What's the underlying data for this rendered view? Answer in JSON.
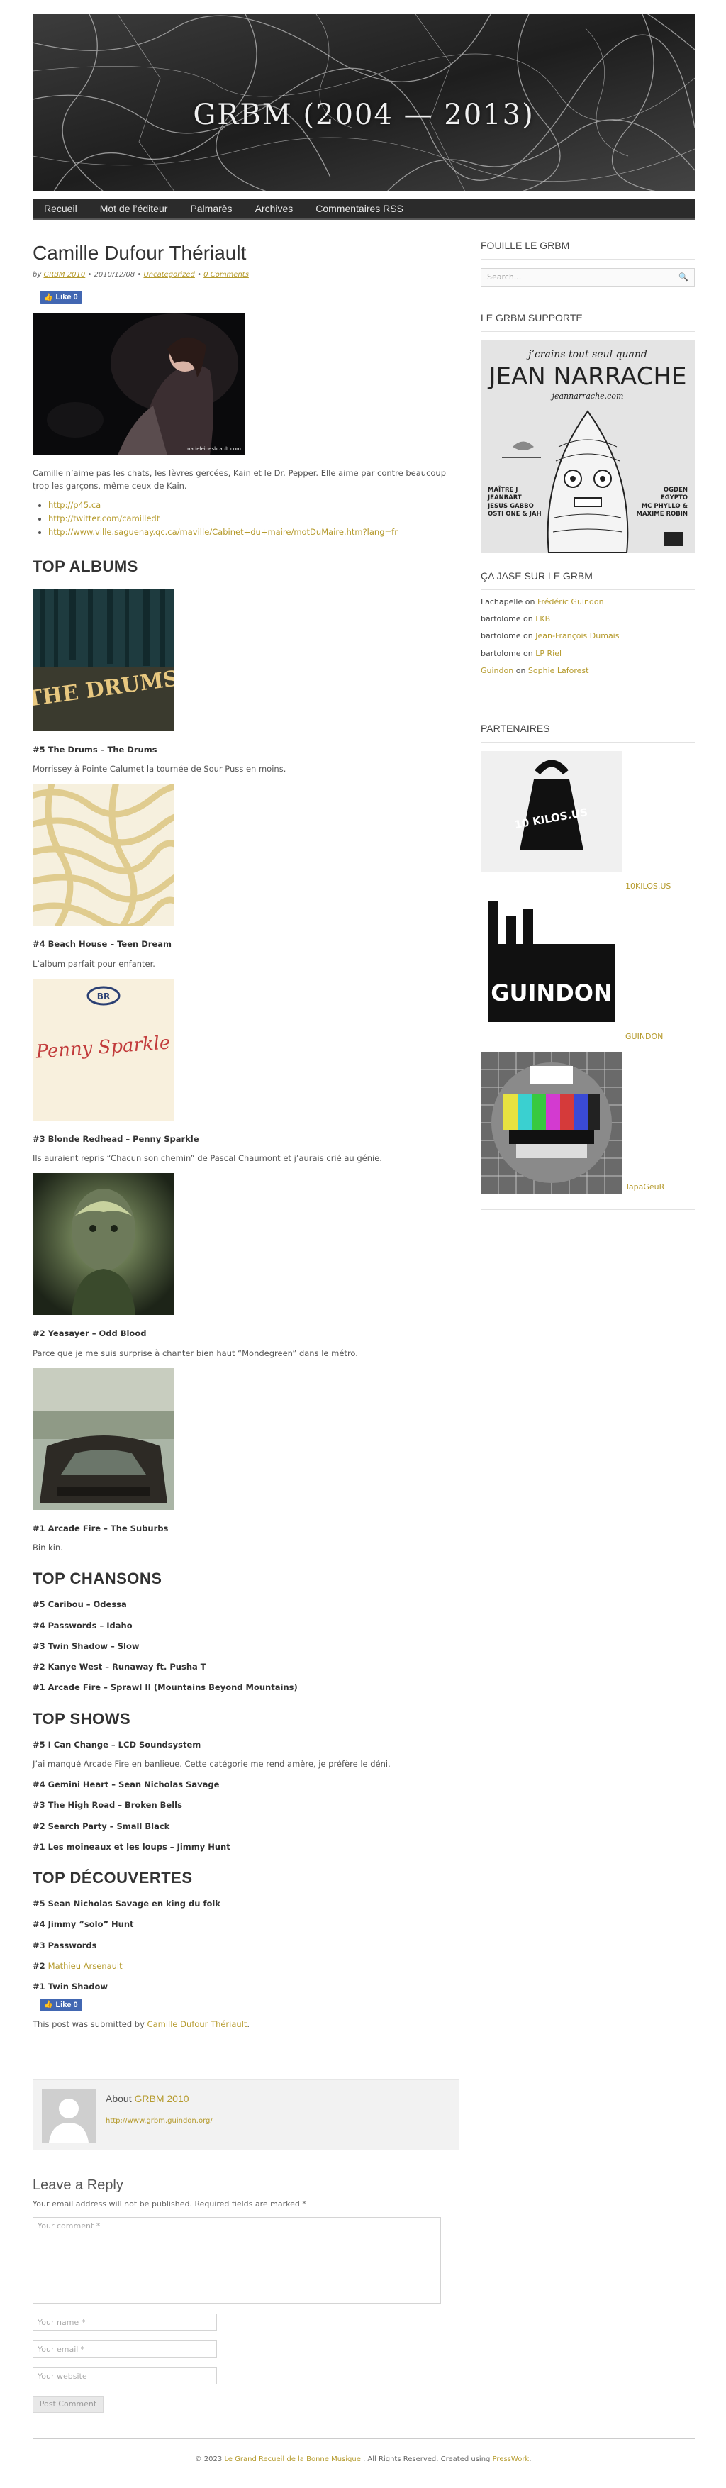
{
  "site": {
    "banner_title": "GRBM (2004 — 2013)",
    "nav": [
      "Recueil",
      "Mot de l’éditeur",
      "Palmarès",
      "Archives",
      "Commentaires RSS"
    ]
  },
  "post": {
    "title": "Camille Dufour Thériault",
    "meta_by": "by",
    "meta_author": "GRBM 2010",
    "meta_date": " • 2010/12/08 • ",
    "meta_category": "Uncategorized",
    "meta_sep": " • ",
    "meta_comments": "0 Comments",
    "like_label": "Like 0",
    "image_watermark": "madeleinesbrault.com",
    "intro": "Camille n’aime pas les chats, les lèvres gercées, Kain et le Dr. Pepper. Elle aime par contre beaucoup trop les garçons, même ceux de Kain.",
    "links": [
      "http://p45.ca",
      "http://twitter.com/camilledt",
      "http://www.ville.saguenay.qc.ca/maville/Cabinet+du+maire/motDuMaire.htm?lang=fr"
    ],
    "albums_heading": "TOP ALBUMS",
    "albums": [
      {
        "title": "#5 The Drums – The Drums",
        "desc": "Morrissey à Pointe Calumet la tournée de Sour Puss en moins."
      },
      {
        "title": "#4 Beach House – Teen Dream",
        "desc": "L’album parfait pour enfanter."
      },
      {
        "title": "#3 Blonde Redhead – Penny Sparkle",
        "desc": "Ils auraient repris “Chacun son chemin” de Pascal Chaumont et j’aurais crié au génie."
      },
      {
        "title": "#2 Yeasayer – Odd Blood",
        "desc": "Parce que je me suis surprise à chanter bien haut “Mondegreen” dans le métro."
      },
      {
        "title": "#1 Arcade Fire – The Suburbs",
        "desc": "Bin kin."
      }
    ],
    "album_art_text": {
      "drums": "THE DRUMS",
      "penny": "Penny Sparkle",
      "penny_badge": "BR"
    },
    "songs_heading": "TOP CHANSONS",
    "songs": [
      "#5 Caribou – Odessa",
      "#4 Passwords – Idaho",
      "#3 Twin Shadow – Slow",
      "#2 Kanye West – Runaway ft. Pusha T",
      "#1 Arcade Fire – Sprawl II (Mountains Beyond Mountains)"
    ],
    "shows_heading": "TOP SHOWS",
    "show_first": "#5 I Can Change – LCD Soundsystem",
    "show_first_desc": "J’ai manqué Arcade Fire en banlieue. Cette catégorie me rend amère, je préfère le déni.",
    "shows_rest": [
      "#4 Gemini Heart – Sean Nicholas Savage",
      "#3 The High Road – Broken Bells",
      "#2 Search Party – Small Black",
      "#1 Les moineaux et les loups – Jimmy Hunt"
    ],
    "discoveries_heading": "TOP DÉCOUVERTES",
    "disc_5": "#5 Sean Nicholas Savage en king du folk",
    "disc_4": "#4 Jimmy “solo” Hunt",
    "disc_3": "#3 Passwords",
    "disc_2_prefix": "#2 ",
    "disc_2_link": "Mathieu Arsenault",
    "disc_1": "#1 Twin Shadow",
    "submitted_prefix": "This post was submitted by ",
    "submitted_link": "Camille Dufour Thériault",
    "submitted_suffix": "."
  },
  "author_box": {
    "about_prefix": "About ",
    "name": "GRBM 2010",
    "url": "http://www.grbm.guindon.org/"
  },
  "reply": {
    "title": "Leave a Reply",
    "note": "Your email address will not be published. Required fields are marked *",
    "comment_placeholder": "Your comment *",
    "name_placeholder": "Your name *",
    "email_placeholder": "Your email *",
    "website_placeholder": "Your website",
    "submit": "Post Comment"
  },
  "sidebar": {
    "search_title": "FOUILLE LE GRBM",
    "search_placeholder": "Search...",
    "support_title": "LE GRBM SUPPORTE",
    "poster": {
      "top_line": "j’crains tout seul quand",
      "name": "JEAN NARRACHE",
      "site": "jeannarrache.com",
      "left": [
        "MAÎTRE J",
        "JEANBART",
        "JESUS GABBO",
        "OSTI ONE & JAH"
      ],
      "right": [
        "OGDEN",
        "EGYPTO",
        "MC PHYLLO &",
        "MAXIME ROBIN"
      ]
    },
    "recent_title": "ÇA JASE SUR LE GRBM",
    "recent": [
      {
        "author": "Lachapelle",
        "on": " on ",
        "post": "Frédéric Guindon"
      },
      {
        "author": "bartolome",
        "on": " on ",
        "post": "LKB"
      },
      {
        "author": "bartolome",
        "on": " on ",
        "post": "Jean-François Dumais"
      },
      {
        "author": "bartolome",
        "on": " on ",
        "post": "LP Riel"
      },
      {
        "author": "Guindon",
        "on": " on ",
        "post": "Sophie Laforest"
      }
    ],
    "partners_title": "PARTENAIRES",
    "partners": [
      {
        "label": "10KILOS.US",
        "art": "10 KILOS.US"
      },
      {
        "label": "GUINDON",
        "art": "GUINDON"
      },
      {
        "label": "TapaGeuR",
        "art": ""
      }
    ]
  },
  "footer": {
    "prefix": "© 2023 ",
    "site_link": "Le Grand Recueil de la Bonne Musique",
    "middle": " . All Rights Reserved. Created using ",
    "theme_link": "PressWork",
    "suffix": "."
  },
  "colors": {
    "link": "#b59a2c",
    "nav_bg": "#2b2b2b",
    "like": "#4267b2"
  }
}
